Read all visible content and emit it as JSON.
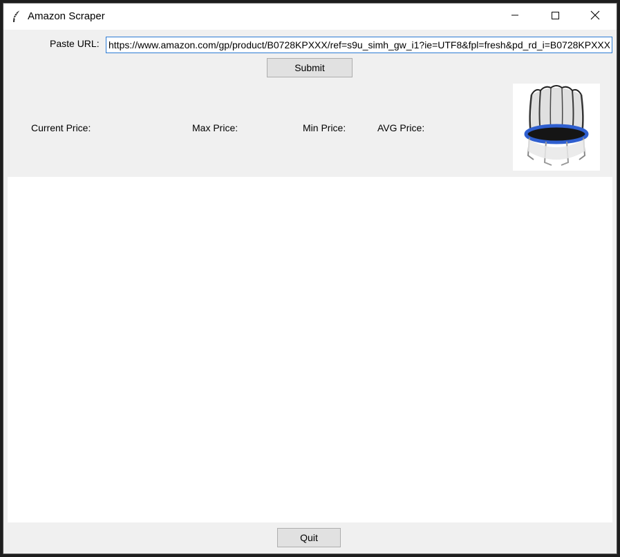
{
  "window": {
    "title": "Amazon Scraper",
    "icon": "feather-icon",
    "controls": [
      "minimize-icon",
      "maximize-icon",
      "close-icon"
    ]
  },
  "url_form": {
    "label": "Paste URL:",
    "value": "https://www.amazon.com/gp/product/B0728KPXXX/ref=s9u_simh_gw_i1?ie=UTF8&fpl=fresh&pd_rd_i=B0728KPXXX",
    "submit_label": "Submit"
  },
  "prices": {
    "current_label": "Current Price:",
    "max_label": "Max Price:",
    "min_label": "Min Price:",
    "avg_label": "AVG Price:"
  },
  "product": {
    "image": "trampoline-image"
  },
  "footer": {
    "quit_label": "Quit"
  }
}
